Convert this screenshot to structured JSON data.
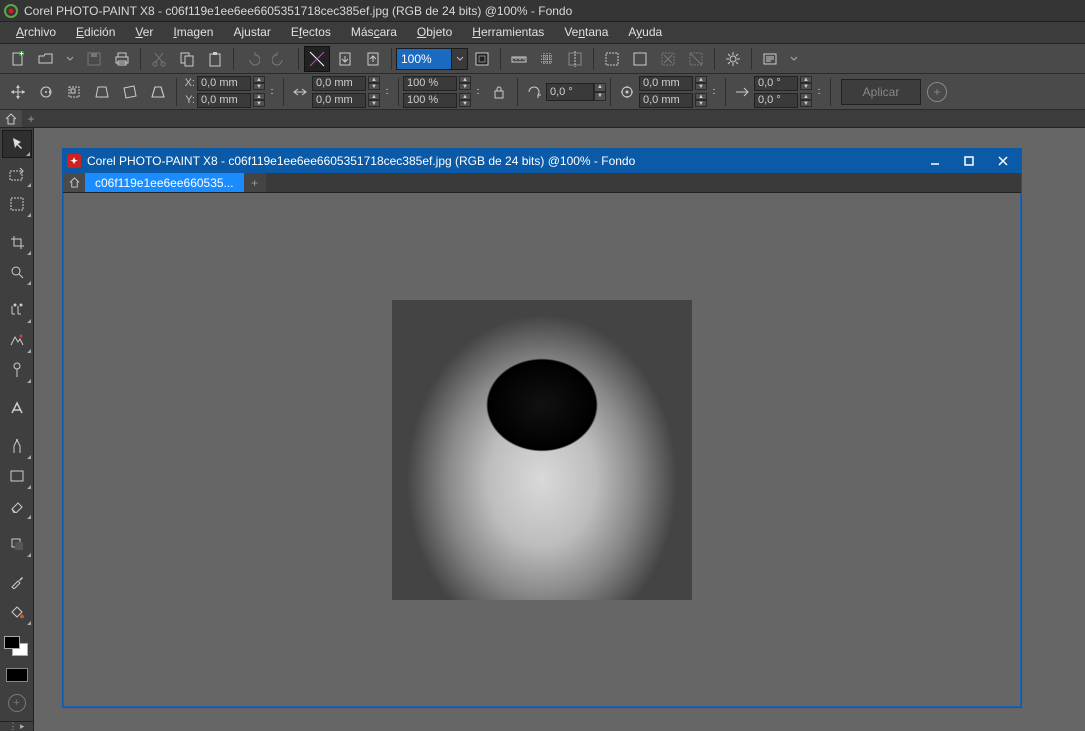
{
  "app": {
    "title": "Corel PHOTO-PAINT X8 - c06f119e1ee6ee6605351718cec385ef.jpg (RGB de 24 bits) @100% - Fondo"
  },
  "menu": {
    "archivo": "Archivo",
    "edicion": "Edición",
    "ver": "Ver",
    "imagen": "Imagen",
    "ajustar": "Ajustar",
    "efectos": "Efectos",
    "mascara": "Máscara",
    "objeto": "Objeto",
    "herramientas": "Herramientas",
    "ventana": "Ventana",
    "ayuda": "Ayuda"
  },
  "toolbar": {
    "zoom_value": "100%"
  },
  "props": {
    "x_label": "X:",
    "y_label": "Y:",
    "x_val": "0,0 mm",
    "y_val": "0,0 mm",
    "w_val": "0,0 mm",
    "h_val": "0,0 mm",
    "scale_x": "100 %",
    "scale_y": "100 %",
    "rot": "0,0 °",
    "skew_x": "0,0 mm",
    "skew_y": "0,0 mm",
    "ang_x": "0,0 °",
    "ang_y": "0,0 °",
    "apply": "Aplicar"
  },
  "doc": {
    "title": "Corel PHOTO-PAINT X8 - c06f119e1ee6ee6605351718cec385ef.jpg (RGB de 24 bits) @100% - Fondo",
    "tab": "c06f119e1ee6ee660535...",
    "image_alt": "[black-and-white portrait photograph]"
  }
}
